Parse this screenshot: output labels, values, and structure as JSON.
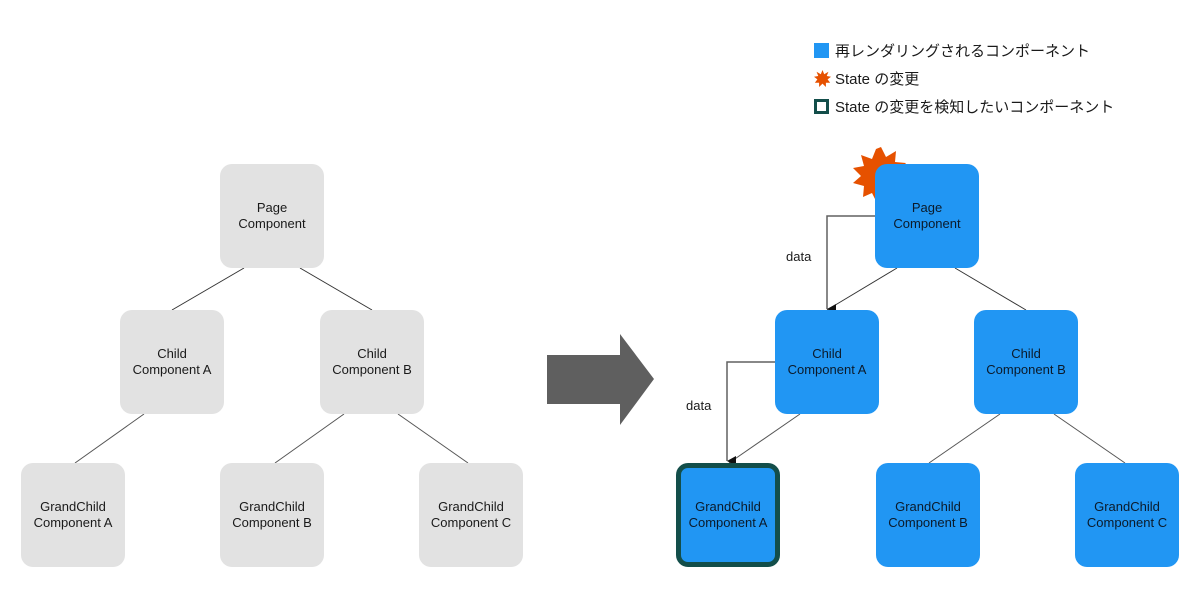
{
  "legend": {
    "items": [
      {
        "icon": "blue-square-icon",
        "label": "再レンダリングされるコンポーネント",
        "color": "#2196f3"
      },
      {
        "icon": "burst-icon",
        "label": "State の変更",
        "color": "#e65100"
      },
      {
        "icon": "outlined-square-icon",
        "label": "State の変更を検知したいコンポーネント",
        "color": "#134e4a"
      }
    ]
  },
  "colors": {
    "inactive": "#e2e2e2",
    "rerender": "#2196f3",
    "state_change": "#e65100",
    "watcher_border": "#134e4a",
    "arrow": "#616161"
  },
  "before_tree": {
    "nodes": [
      {
        "id": "page",
        "label": "Page\nComponent"
      },
      {
        "id": "childA",
        "label": "Child\nComponent A"
      },
      {
        "id": "childB",
        "label": "Child\nComponent B"
      },
      {
        "id": "gcA",
        "label": "GrandChild\nComponent A"
      },
      {
        "id": "gcB",
        "label": "GrandChild\nComponent B"
      },
      {
        "id": "gcC",
        "label": "GrandChild\nComponent C"
      }
    ]
  },
  "after_tree": {
    "nodes": [
      {
        "id": "page",
        "label": "Page\nComponent",
        "state_change": true
      },
      {
        "id": "childA",
        "label": "Child\nComponent A"
      },
      {
        "id": "childB",
        "label": "Child\nComponent B"
      },
      {
        "id": "gcA",
        "label": "GrandChild\nComponent A",
        "watcher": true
      },
      {
        "id": "gcB",
        "label": "GrandChild\nComponent B"
      },
      {
        "id": "gcC",
        "label": "GrandChild\nComponent C"
      }
    ],
    "data_flow_labels": [
      "data",
      "data"
    ]
  },
  "transition_arrow": "right-arrow-icon"
}
